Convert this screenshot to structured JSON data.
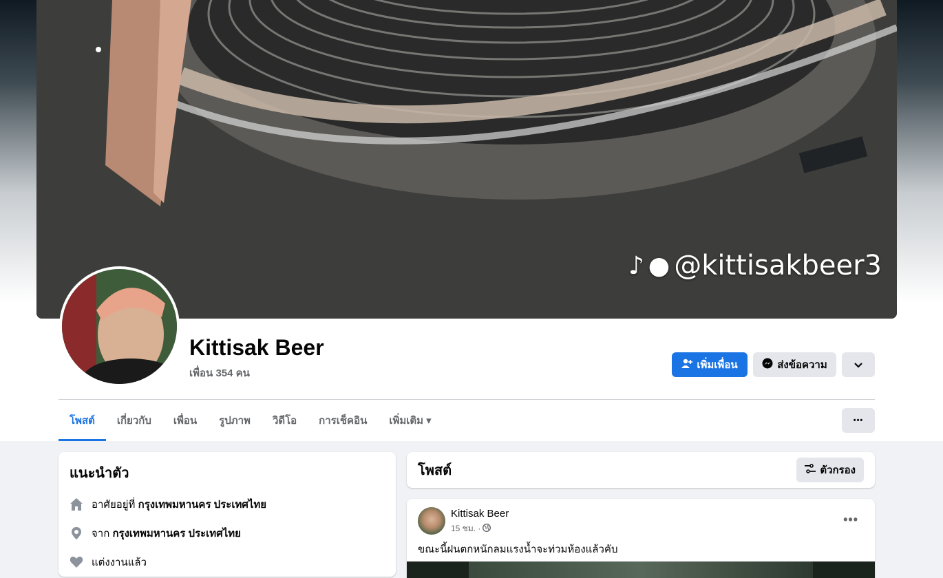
{
  "cover": {
    "watermark_handle": "@kittisakbeer3",
    "watermark_icons": [
      "tiktok-icon",
      "person-icon"
    ]
  },
  "profile": {
    "name": "Kittisak Beer",
    "friends": "เพื่อน 354 คน"
  },
  "actions": {
    "add_friend": "เพิ่มเพื่อน",
    "message": "ส่งข้อความ",
    "more_caret": "▾",
    "more_dots": "•••"
  },
  "tabs": [
    {
      "label": "โพสต์",
      "active": true
    },
    {
      "label": "เกี่ยวกับ"
    },
    {
      "label": "เพื่อน"
    },
    {
      "label": "รูปภาพ"
    },
    {
      "label": "วิดีโอ"
    },
    {
      "label": "การเช็คอิน"
    },
    {
      "label": "เพิ่มเติม ▾"
    }
  ],
  "intro": {
    "title": "แนะนำตัว",
    "lives_prefix": "อาศัยอยู่ที่ ",
    "lives_place": "กรุงเทพมหานคร ประเทศไทย",
    "from_prefix": "จาก ",
    "from_place": "กรุงเทพมหานคร ประเทศไทย",
    "relationship": "แต่งงานแล้ว"
  },
  "posts_header": {
    "title": "โพสต์",
    "filter": "ตัวกรอง"
  },
  "post": {
    "author": "Kittisak Beer",
    "time": "15 ชม. ·",
    "text": "ขณะนี้ฝนตกหนักลมแรงน้ำจะท่วมห้องแล้วคับ"
  },
  "colors": {
    "primary": "#1b74e4",
    "secondary_btn": "#e4e6eb",
    "page_bg": "#f0f2f5",
    "muted_text": "#65676b"
  }
}
